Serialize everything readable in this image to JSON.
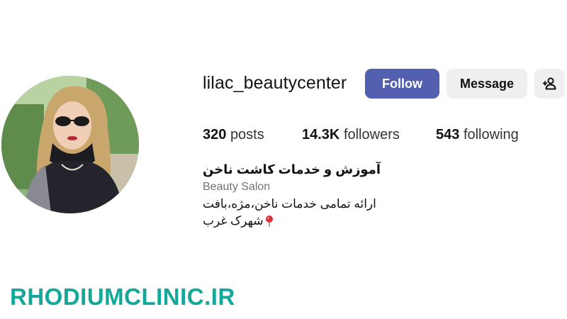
{
  "profile": {
    "username": "lilac_beautycenter",
    "avatar_icon": "profile-photo"
  },
  "actions": {
    "follow_label": "Follow",
    "message_label": "Message",
    "suggest_icon": "add-person-icon",
    "follow_color": "#5360b0",
    "secondary_color": "#efeff1"
  },
  "stats": {
    "posts_count": "320",
    "posts_label": "posts",
    "followers_count": "14.3K",
    "followers_label": "followers",
    "following_count": "543",
    "following_label": "following"
  },
  "bio": {
    "name": "آموزش و خدمات کاشت ناخن",
    "category": "Beauty Salon",
    "line1": "ارائه تمامی خدمات ناخن،مژه،بافت",
    "line2": "شهرک غرب",
    "line2_icon": "round-pushpin-icon"
  },
  "watermark": {
    "text": "RHODIUMCLINIC.IR",
    "color": "#14a79a"
  }
}
